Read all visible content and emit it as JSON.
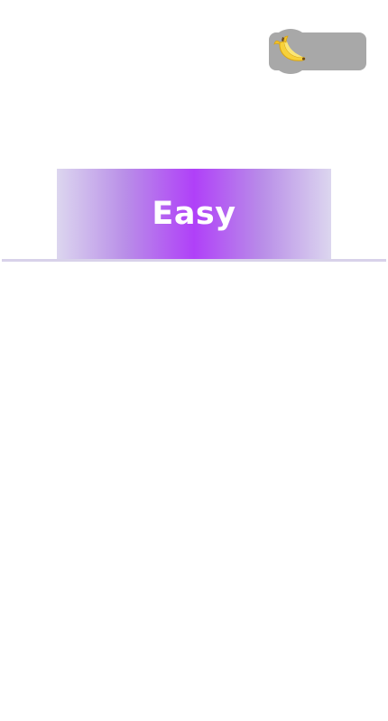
{
  "currency": {
    "icon": "banana-icon",
    "value": ""
  },
  "difficulty": {
    "label": "Easy"
  },
  "colors": {
    "accent": "#b040f8",
    "banner_edge": "#dcd6ef",
    "pill": "#a8a8a8",
    "divider": "#d8d2ea"
  }
}
